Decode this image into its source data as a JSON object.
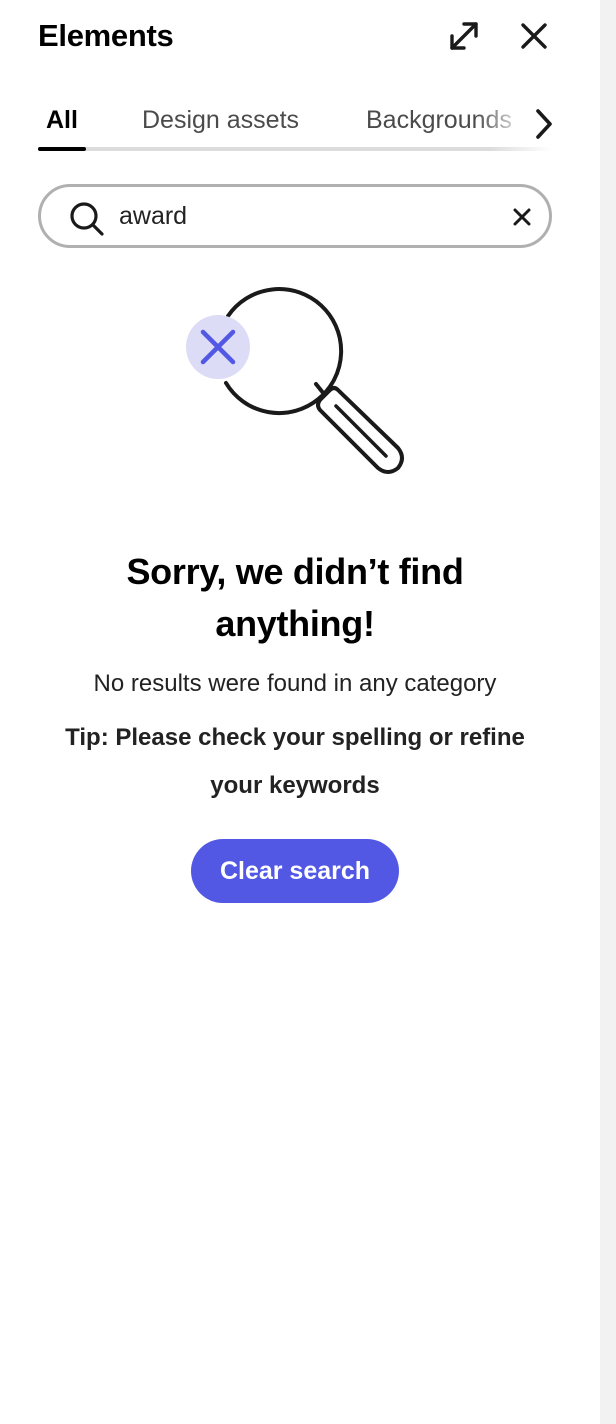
{
  "panel": {
    "title": "Elements",
    "expand_icon": "expand-arrows-icon",
    "close_icon": "close-icon"
  },
  "tabs": {
    "items": [
      {
        "label": "All",
        "active": true
      },
      {
        "label": "Design assets",
        "active": false
      },
      {
        "label": "Backgrounds",
        "active": false
      }
    ],
    "next_icon": "chevron-right-icon"
  },
  "search": {
    "value": "award",
    "icon": "search-icon",
    "clear_icon": "clear-icon"
  },
  "empty_state": {
    "illustration": "magnifier-no-results-icon",
    "heading": "Sorry, we didn’t find anything!",
    "subtext": "No results were found in any category",
    "tip": "Tip: Please check your spelling or refine your keywords",
    "button_label": "Clear search"
  },
  "colors": {
    "accent": "#5258e4",
    "accent_light": "#dcdcf6"
  }
}
